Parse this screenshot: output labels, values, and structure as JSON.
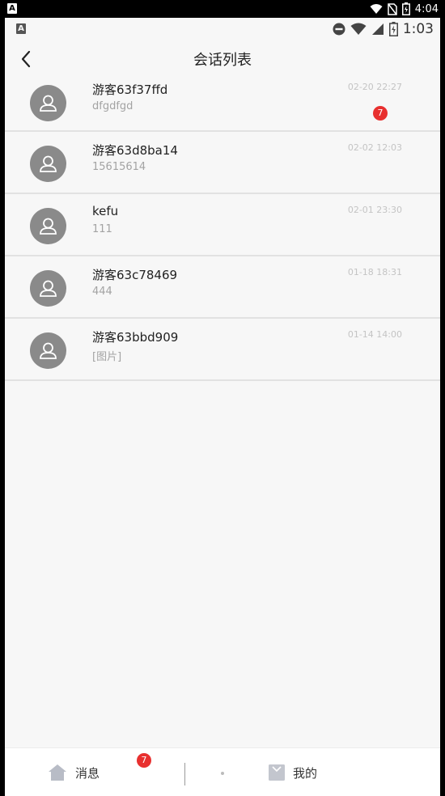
{
  "device_status": {
    "time": "4:04"
  },
  "app_status": {
    "time": "1:03"
  },
  "header": {
    "title": "会话列表"
  },
  "conversations": [
    {
      "name": "游客63f37ffd",
      "preview": "dfgdfgd",
      "time": "02-20 22:27",
      "unread": "7"
    },
    {
      "name": "游客63d8ba14",
      "preview": "15615614",
      "time": "02-02 12:03"
    },
    {
      "name": "kefu",
      "preview": "111",
      "time": "02-01 23:30"
    },
    {
      "name": "游客63c78469",
      "preview": "444",
      "time": "01-18 18:31"
    },
    {
      "name": "游客63bbd909",
      "preview": "[图片]",
      "time": "01-14 14:00"
    }
  ],
  "tabbar": {
    "messages_label": "消息",
    "messages_badge": "7",
    "mine_label": "我的"
  },
  "icons": {
    "back": "chevron-left-icon",
    "avatar": "user-icon",
    "home": "home-icon",
    "mine": "bag-icon"
  },
  "colors": {
    "badge": "#e8302f",
    "background": "#f7f7f7"
  }
}
